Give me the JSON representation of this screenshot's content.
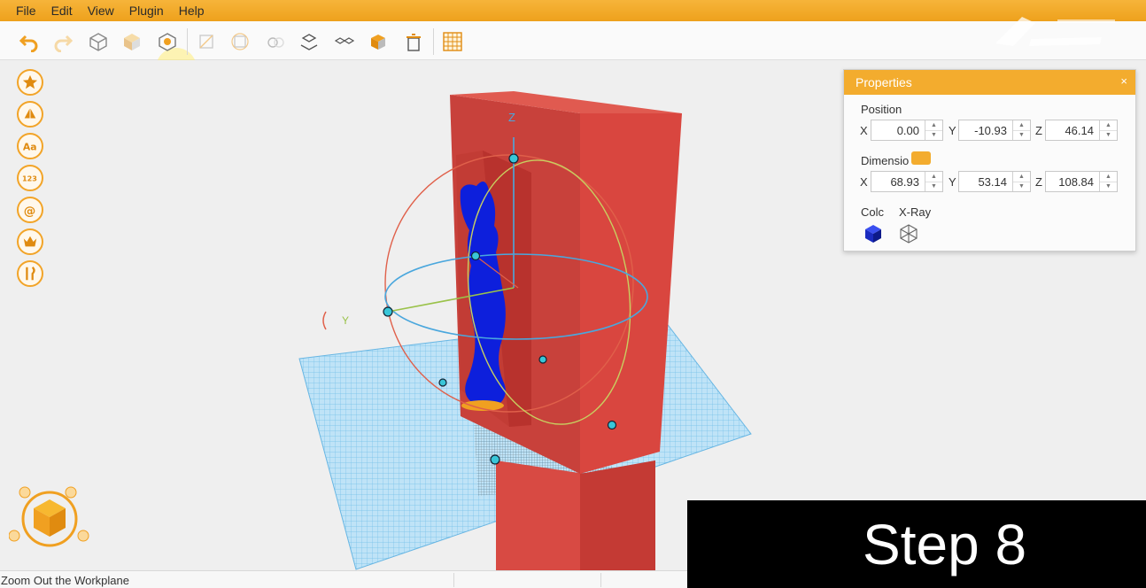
{
  "menu": [
    "File",
    "Edit",
    "View",
    "Plugin",
    "Help"
  ],
  "toolbar": {
    "icons": [
      "undo-icon",
      "redo-icon",
      "cube-outline-icon",
      "cube-shaded-icon",
      "move-icon",
      "scale-icon",
      "rotate-icon",
      "mirror-icon",
      "place-on-bed-icon",
      "split-icon",
      "merge-icon",
      "delete-icon",
      "grid-icon"
    ]
  },
  "sidebar": {
    "icons": [
      "star-icon",
      "shape-icon",
      "text-icon",
      "number-icon",
      "at-icon",
      "crown-icon",
      "tools-icon"
    ]
  },
  "properties": {
    "title": "Properties",
    "close": "×",
    "position_label": "Position",
    "dimension_label": "Dimensio",
    "color_label": "Colc",
    "xray_label": "X-Ray",
    "axis_x": "X",
    "axis_y": "Y",
    "axis_z": "Z",
    "position": {
      "x": "0.00",
      "y": "-10.93",
      "z": "46.14"
    },
    "dimension": {
      "x": "68.93",
      "y": "53.14",
      "z": "108.84"
    },
    "spin_up": "▲",
    "spin_down": "▼"
  },
  "viewport": {
    "axis_z": "Z",
    "axis_y": "Y",
    "model_color": "#d9453f",
    "figure_color": "#0d1fdc",
    "grid_color": "#7cc3ea"
  },
  "status": {
    "text": "Zoom Out the Workplane"
  },
  "overlay": {
    "text": "Step 8"
  },
  "accent": "#f3ac2e"
}
